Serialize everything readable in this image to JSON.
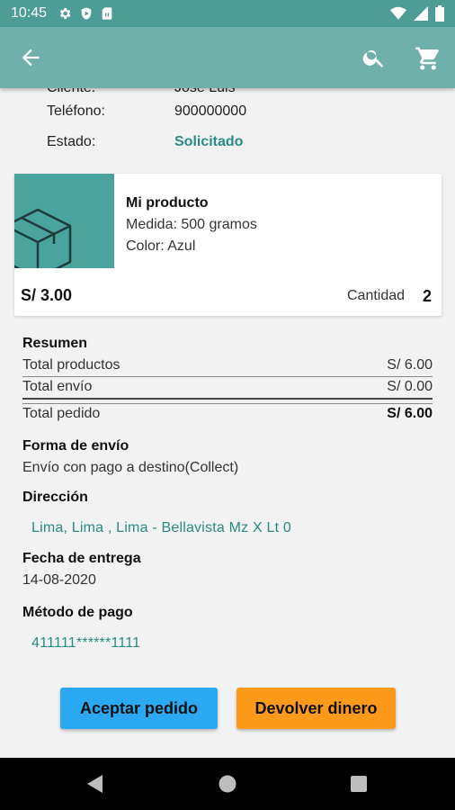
{
  "status_bar": {
    "time": "10:45",
    "icons": [
      "gear-icon",
      "shield-icon",
      "sim-icon",
      "wifi-icon",
      "signal-icon",
      "battery-icon"
    ]
  },
  "app_bar": {
    "icons": [
      "back-arrow-icon",
      "search-icon",
      "cart-icon"
    ]
  },
  "customer": {
    "cliente_label": "Cliente:",
    "cliente_value": "Jose Luis",
    "telefono_label": "Teléfono:",
    "telefono_value": "900000000",
    "estado_label": "Estado:",
    "estado_value": "Solicitado"
  },
  "product": {
    "name": "Mi producto",
    "medida": "Medida: 500 gramos",
    "color": "Color: Azul",
    "price": "S/ 3.00",
    "cantidad_label": "Cantidad",
    "cantidad_value": "2"
  },
  "resumen": {
    "title": "Resumen",
    "total_productos_label": "Total productos",
    "total_productos_value": "S/ 6.00",
    "total_envio_label": "Total envío",
    "total_envio_value": "S/ 0.00",
    "total_pedido_label": "Total pedido",
    "total_pedido_value": "S/ 6.00"
  },
  "envio": {
    "title": "Forma de envío",
    "value": "Envío con pago a destino(Collect)"
  },
  "direccion": {
    "title": "Dirección",
    "value": "Lima, Lima , Lima - Bellavista Mz X Lt 0"
  },
  "entrega": {
    "title": "Fecha de entrega",
    "value": "14-08-2020"
  },
  "pago": {
    "title": "Método de pago",
    "value": "411111******1111"
  },
  "actions": {
    "accept_label": "Aceptar pedido",
    "refund_label": "Devolver dinero"
  },
  "colors": {
    "primary": "#6fb0ab",
    "status_bar": "#4d9c95",
    "accent_text": "#2a8a84",
    "accept": "#2aa8f2",
    "refund": "#fd9a1c"
  }
}
